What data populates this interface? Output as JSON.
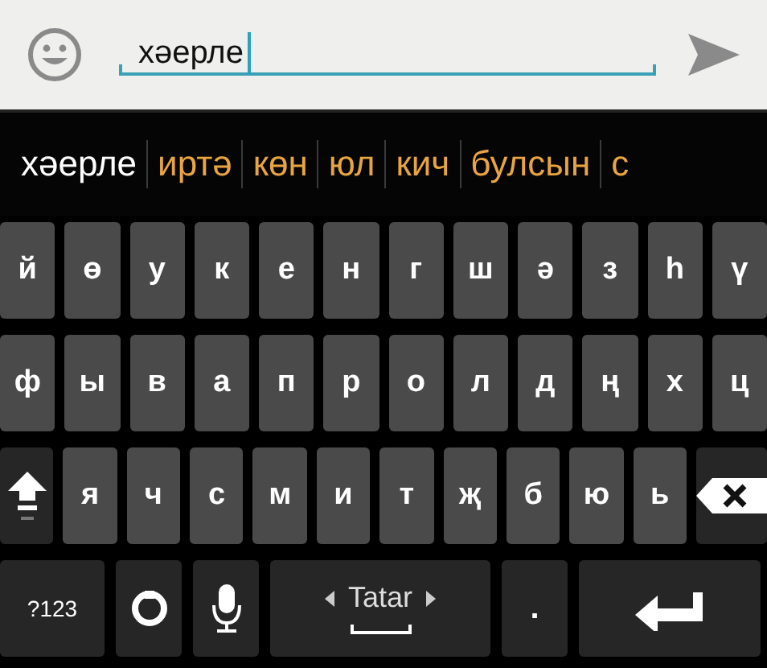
{
  "compose": {
    "value": "хәерле"
  },
  "suggestions": [
    {
      "text": "хәерле",
      "kind": "typed"
    },
    {
      "text": "иртә",
      "kind": "suggestion"
    },
    {
      "text": "көн",
      "kind": "suggestion"
    },
    {
      "text": "юл",
      "kind": "suggestion"
    },
    {
      "text": "кич",
      "kind": "suggestion"
    },
    {
      "text": "булсын",
      "kind": "suggestion"
    },
    {
      "text": "с",
      "kind": "suggestion"
    }
  ],
  "keyboard": {
    "rows": [
      [
        {
          "kind": "letter",
          "label": "й"
        },
        {
          "kind": "letter",
          "label": "ө"
        },
        {
          "kind": "letter",
          "label": "у"
        },
        {
          "kind": "letter",
          "label": "к"
        },
        {
          "kind": "letter",
          "label": "е"
        },
        {
          "kind": "letter",
          "label": "н"
        },
        {
          "kind": "letter",
          "label": "г"
        },
        {
          "kind": "letter",
          "label": "ш"
        },
        {
          "kind": "letter",
          "label": "ә"
        },
        {
          "kind": "letter",
          "label": "з"
        },
        {
          "kind": "letter",
          "label": "һ"
        },
        {
          "kind": "letter",
          "label": "ү"
        }
      ],
      [
        {
          "kind": "letter",
          "label": "ф"
        },
        {
          "kind": "letter",
          "label": "ы"
        },
        {
          "kind": "letter",
          "label": "в"
        },
        {
          "kind": "letter",
          "label": "а"
        },
        {
          "kind": "letter",
          "label": "п"
        },
        {
          "kind": "letter",
          "label": "р"
        },
        {
          "kind": "letter",
          "label": "о"
        },
        {
          "kind": "letter",
          "label": "л"
        },
        {
          "kind": "letter",
          "label": "д"
        },
        {
          "kind": "letter",
          "label": "ң"
        },
        {
          "kind": "letter",
          "label": "х"
        },
        {
          "kind": "letter",
          "label": "ц"
        }
      ],
      [
        {
          "kind": "shift"
        },
        {
          "kind": "letter",
          "label": "я"
        },
        {
          "kind": "letter",
          "label": "ч"
        },
        {
          "kind": "letter",
          "label": "с"
        },
        {
          "kind": "letter",
          "label": "м"
        },
        {
          "kind": "letter",
          "label": "и"
        },
        {
          "kind": "letter",
          "label": "т"
        },
        {
          "kind": "letter",
          "label": "җ"
        },
        {
          "kind": "letter",
          "label": "б"
        },
        {
          "kind": "letter",
          "label": "ю"
        },
        {
          "kind": "letter",
          "label": "ь"
        },
        {
          "kind": "backspace"
        }
      ]
    ],
    "bottom_row": [
      {
        "kind": "symbols",
        "label": "?123"
      },
      {
        "kind": "settings"
      },
      {
        "kind": "mic"
      },
      {
        "kind": "space",
        "label": "Tatar"
      },
      {
        "kind": "period",
        "label": "."
      },
      {
        "kind": "enter"
      }
    ]
  }
}
